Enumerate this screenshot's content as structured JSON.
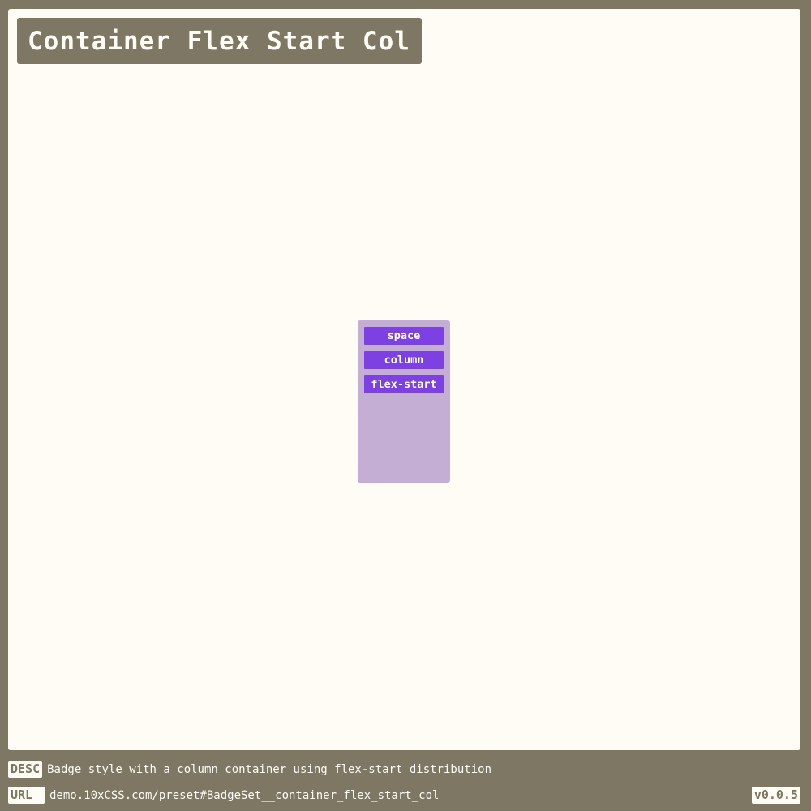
{
  "header": {
    "title": "Container Flex Start Col"
  },
  "badges": [
    {
      "label": "space"
    },
    {
      "label": "column"
    },
    {
      "label": "flex-start"
    }
  ],
  "footer": {
    "desc_tag": "DESC",
    "desc_text": "Badge style with a column container using flex-start distribution",
    "url_tag": "URL",
    "url_text": "demo.10xCSS.com/preset#BadgeSet__container_flex_start_col",
    "version": "v0.0.5"
  },
  "colors": {
    "frame": "#7e7763",
    "canvas": "#fefcf5",
    "container": "#c5aed4",
    "badge": "#7d40e2"
  }
}
